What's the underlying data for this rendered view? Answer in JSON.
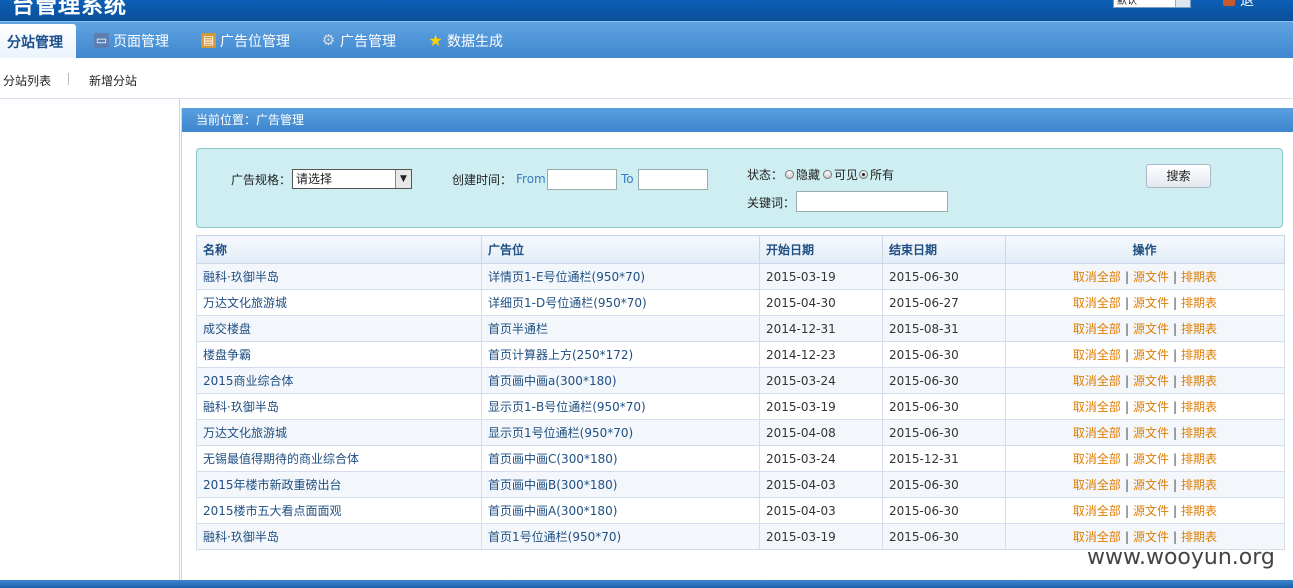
{
  "header": {
    "app_title": "台管理系统",
    "select_value": "默认",
    "right_text": "退"
  },
  "nav": {
    "tabs": [
      {
        "label": "分站管理",
        "icon": "site-icon",
        "active": true
      },
      {
        "label": "页面管理",
        "icon": "page-icon"
      },
      {
        "label": "广告位管理",
        "icon": "ad-position-icon"
      },
      {
        "label": "广告管理",
        "icon": "gear-icon"
      },
      {
        "label": "数据生成",
        "icon": "star-icon"
      }
    ]
  },
  "subnav": {
    "items": [
      "分站列表",
      "新增分站"
    ]
  },
  "breadcrumb": "当前位置：广告管理",
  "filter": {
    "spec_label": "广告规格：",
    "spec_value": "请选择",
    "created_label": "创建时间：",
    "from_label": "From",
    "to_label": "To",
    "from_value": "",
    "to_value": "",
    "status_label": "状态：",
    "status_options": [
      "隐藏",
      "可见",
      "所有"
    ],
    "status_selected": "所有",
    "keyword_label": "关键词：",
    "keyword_value": "",
    "search_button": "搜索"
  },
  "table": {
    "headers": [
      "名称",
      "广告位",
      "开始日期",
      "结束日期",
      "操作"
    ],
    "rows": [
      {
        "name": "融科·玖御半岛",
        "position": "详情页1-E号位通栏(950*70)",
        "start": "2015-03-19",
        "end": "2015-06-30"
      },
      {
        "name": "万达文化旅游城",
        "position": "详细页1-D号位通栏(950*70)",
        "start": "2015-04-30",
        "end": "2015-06-27"
      },
      {
        "name": "成交楼盘",
        "position": "首页半通栏",
        "start": "2014-12-31",
        "end": "2015-08-31"
      },
      {
        "name": "楼盘争霸",
        "position": "首页计算器上方(250*172)",
        "start": "2014-12-23",
        "end": "2015-06-30"
      },
      {
        "name": "2015商业综合体",
        "position": "首页画中画a(300*180)",
        "start": "2015-03-24",
        "end": "2015-06-30"
      },
      {
        "name": "融科·玖御半岛",
        "position": "显示页1-B号位通栏(950*70)",
        "start": "2015-03-19",
        "end": "2015-06-30"
      },
      {
        "name": "万达文化旅游城",
        "position": "显示页1号位通栏(950*70)",
        "start": "2015-04-08",
        "end": "2015-06-30"
      },
      {
        "name": "无锡最值得期待的商业综合体",
        "position": "首页画中画C(300*180)",
        "start": "2015-03-24",
        "end": "2015-12-31"
      },
      {
        "name": "2015年楼市新政重磅出台",
        "position": "首页画中画B(300*180)",
        "start": "2015-04-03",
        "end": "2015-06-30"
      },
      {
        "name": "2015楼市五大看点面面观",
        "position": "首页画中画A(300*180)",
        "start": "2015-04-03",
        "end": "2015-06-30"
      },
      {
        "name": "融科·玖御半岛",
        "position": "首页1号位通栏(950*70)",
        "start": "2015-03-19",
        "end": "2015-06-30"
      }
    ],
    "actions": [
      "取消全部",
      "源文件",
      "排期表"
    ]
  },
  "watermark": "www.wooyun.org",
  "colors": {
    "header_bg": "#0d60b6",
    "nav_bg": "#4a90d9",
    "filter_bg": "#cfeef1",
    "action_link": "#e07d00",
    "name_text": "#1f4f83"
  }
}
